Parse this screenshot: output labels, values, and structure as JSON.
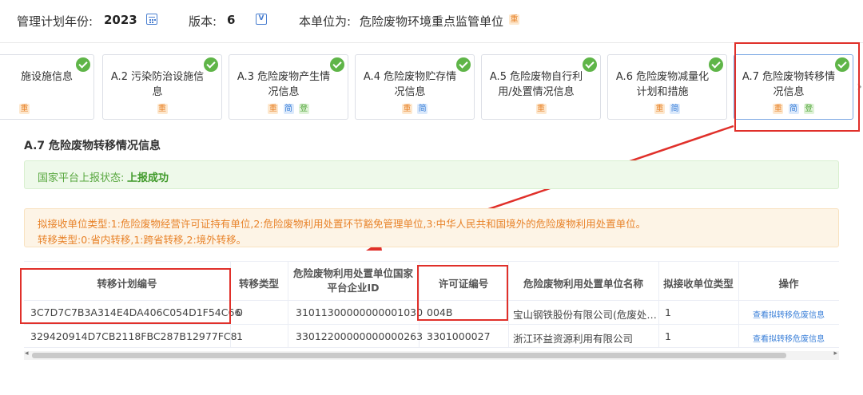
{
  "header": {
    "year_label": "管理计划年份:",
    "year_value": "2023",
    "version_label": "版本:",
    "version_value": "6",
    "unit_label": "本单位为:",
    "unit_value": "危险废物环境重点监管单位",
    "unit_tag": "重"
  },
  "steps": [
    {
      "title": "施设施信息",
      "tags": [
        "重"
      ]
    },
    {
      "title": "A.2 污染防治设施信息",
      "tags": [
        "重"
      ]
    },
    {
      "title": "A.3 危险废物产生情况信息",
      "tags": [
        "重",
        "简",
        "登"
      ]
    },
    {
      "title": "A.4 危险废物贮存情况信息",
      "tags": [
        "重",
        "简"
      ]
    },
    {
      "title": "A.5 危险废物自行利用/处置情况信息",
      "tags": [
        "重"
      ]
    },
    {
      "title": "A.6 危险废物减量化计划和措施",
      "tags": [
        "重",
        "简"
      ]
    },
    {
      "title": "A.7 危险废物转移情况信息",
      "tags": [
        "重",
        "简",
        "登"
      ]
    }
  ],
  "tag_colors": {
    "重": "#e8832a",
    "简": "#3a7fd8",
    "登": "#52a63a"
  },
  "section": {
    "title": "A.7 危险废物转移情况信息",
    "status_label": "国家平台上报状态:",
    "status_value": "上报成功",
    "note_line1": "拟接收单位类型:1:危险废物经营许可证持有单位,2:危险废物利用处置环节豁免管理单位,3:中华人民共和国境外的危险废物利用处置单位。",
    "note_line2": "转移类型:0:省内转移,1:跨省转移,2:境外转移。"
  },
  "table": {
    "headers": [
      "转移计划编号",
      "转移类型",
      "危险废物利用处置单位国家平台企业ID",
      "许可证编号",
      "危险废物利用处置单位名称",
      "拟接收单位类型",
      "操作"
    ],
    "rows": [
      [
        "3C7D7C7B3A314E4DA406C054D1F54C66",
        "0",
        "31011300000000001030",
        "004B",
        "宝山钢铁股份有限公司(危废处…",
        "1",
        "查看拟转移危废信息"
      ],
      [
        "329420914D7CB2118FBC287B12977FC8",
        "1",
        "33012200000000000263",
        "3301000027",
        "浙江环益资源利用有限公司",
        "1",
        "查看拟转移危废信息"
      ]
    ]
  },
  "colors": {
    "accent_red": "#e0302a",
    "success_green": "#5fb548",
    "link_blue": "#3a7fd8",
    "warning_orange": "#e8832a"
  }
}
